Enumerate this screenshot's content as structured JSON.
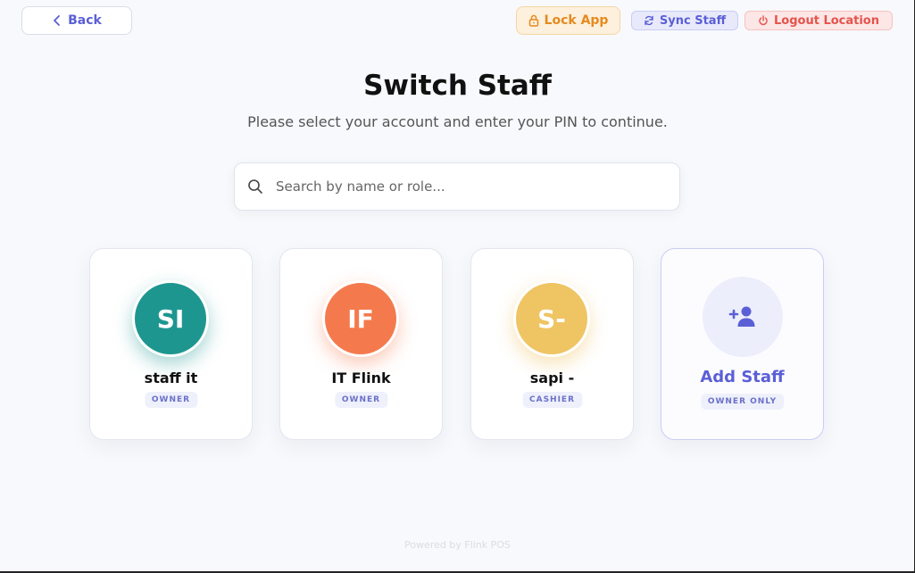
{
  "header": {
    "back_label": "Back",
    "lock_label": "Lock App",
    "sync_label": "Sync Staff",
    "logout_label": "Logout Location"
  },
  "page": {
    "title": "Switch Staff",
    "subtitle": "Please select your account and enter your PIN to continue."
  },
  "search": {
    "placeholder": "Search by name or role..."
  },
  "staff": [
    {
      "initials": "SI",
      "name": "staff it",
      "role": "OWNER",
      "color": "#1e9690"
    },
    {
      "initials": "IF",
      "name": "IT Flink",
      "role": "OWNER",
      "color": "#f47a4d"
    },
    {
      "initials": "S-",
      "name": "sapi -",
      "role": "CASHIER",
      "color": "#efc463"
    }
  ],
  "add_staff": {
    "label": "Add Staff",
    "badge": "OWNER ONLY"
  },
  "footer": {
    "text": "Powered by Flink POS"
  },
  "colors": {
    "accent": "#5b5fd6",
    "lock": "#e58a1f",
    "logout": "#e5534b"
  },
  "icons": {
    "back": "chevron-left-icon",
    "lock": "lock-icon",
    "sync": "sync-icon",
    "logout": "power-icon",
    "search": "search-icon",
    "add_staff": "user-plus-icon"
  }
}
